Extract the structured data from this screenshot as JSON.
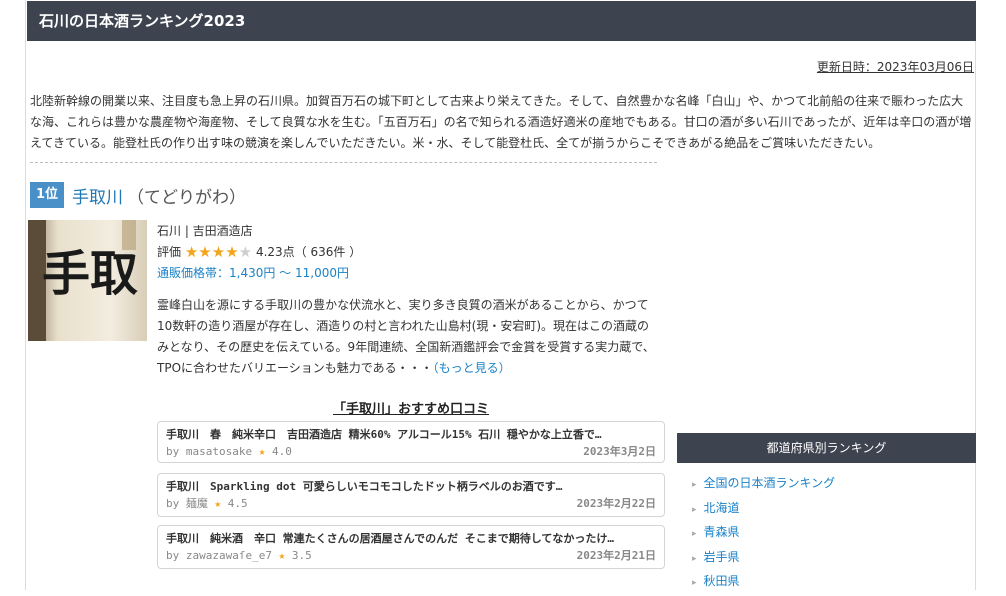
{
  "page_title": "石川の日本酒ランキング2023",
  "updated": "更新日時：2023年03月06日",
  "intro": "北陸新幹線の開業以来、注目度も急上昇の石川県。加賀百万石の城下町として古来より栄えてきた。そして、自然豊かな名峰「白山」や、かつて北前船の往来で賑わった広大な海、これらは豊かな農産物や海産物、そして良質な水を生む。「五百万石」の名で知られる酒造好適米の産地でもある。甘口の酒が多い石川であったが、近年は辛口の酒が増えてきている。能登杜氏の作り出す味の競演を楽しんでいただきたい。米・水、そして能登杜氏、全てが揃うからこそできあがる絶品をご賞味いただきたい。",
  "rank": {
    "badge": "1位",
    "name": "手取川",
    "kana": "（てどりがわ）",
    "bottle_label": "手取",
    "location": "石川 | 吉田酒造店",
    "rating_label": "評価",
    "rating_value": 4.23,
    "rating_text": "4.23点（ 636件 ）",
    "price": "通販価格帯：1,430円 ～ 11,000円",
    "description": "霊峰白山を源にする手取川の豊かな伏流水と、実り多き良質の酒米があることから、かつて10数軒の造り酒屋が存在し、酒造りの村と言われた山島村(現・安宕町)。現在はこの酒蔵のみとなり、その歴史を伝えている。9年間連続、全国新酒鑑評会で金賞を受賞する実力蔵で、TPOに合わせたバリエーションも魅力である・・・",
    "more": "（もっと見る）"
  },
  "reviews": {
    "title": "「手取川」おすすめ口コミ",
    "items": [
      {
        "text": "手取川　春　純米辛口　吉田酒造店 精米60% アルコール15% 石川 穏やかな上立香で…",
        "user": "by masatosake",
        "score": "4.0",
        "date": "2023年3月2日"
      },
      {
        "text": "手取川　Sparkling dot 可愛らしいモコモコしたドット柄ラベルのお酒です…",
        "user": "by 麺魔",
        "score": "4.5",
        "date": "2023年2月22日"
      },
      {
        "text": "手取川　純米酒　辛口 常連たくさんの居酒屋さんでのんだ そこまで期待してなかったけ…",
        "user": "by zawazawaſe_e7",
        "score": "3.5",
        "date": "2023年2月21日"
      }
    ]
  },
  "sidebar": {
    "title": "都道府県別ランキング",
    "items": [
      "全国の日本酒ランキング",
      "北海道",
      "青森県",
      "岩手県",
      "秋田県"
    ]
  },
  "colors": {
    "title_bar": "#3e4350",
    "badge": "#4a90c8",
    "link": "#1a82c8",
    "star": "#f2a51a"
  }
}
